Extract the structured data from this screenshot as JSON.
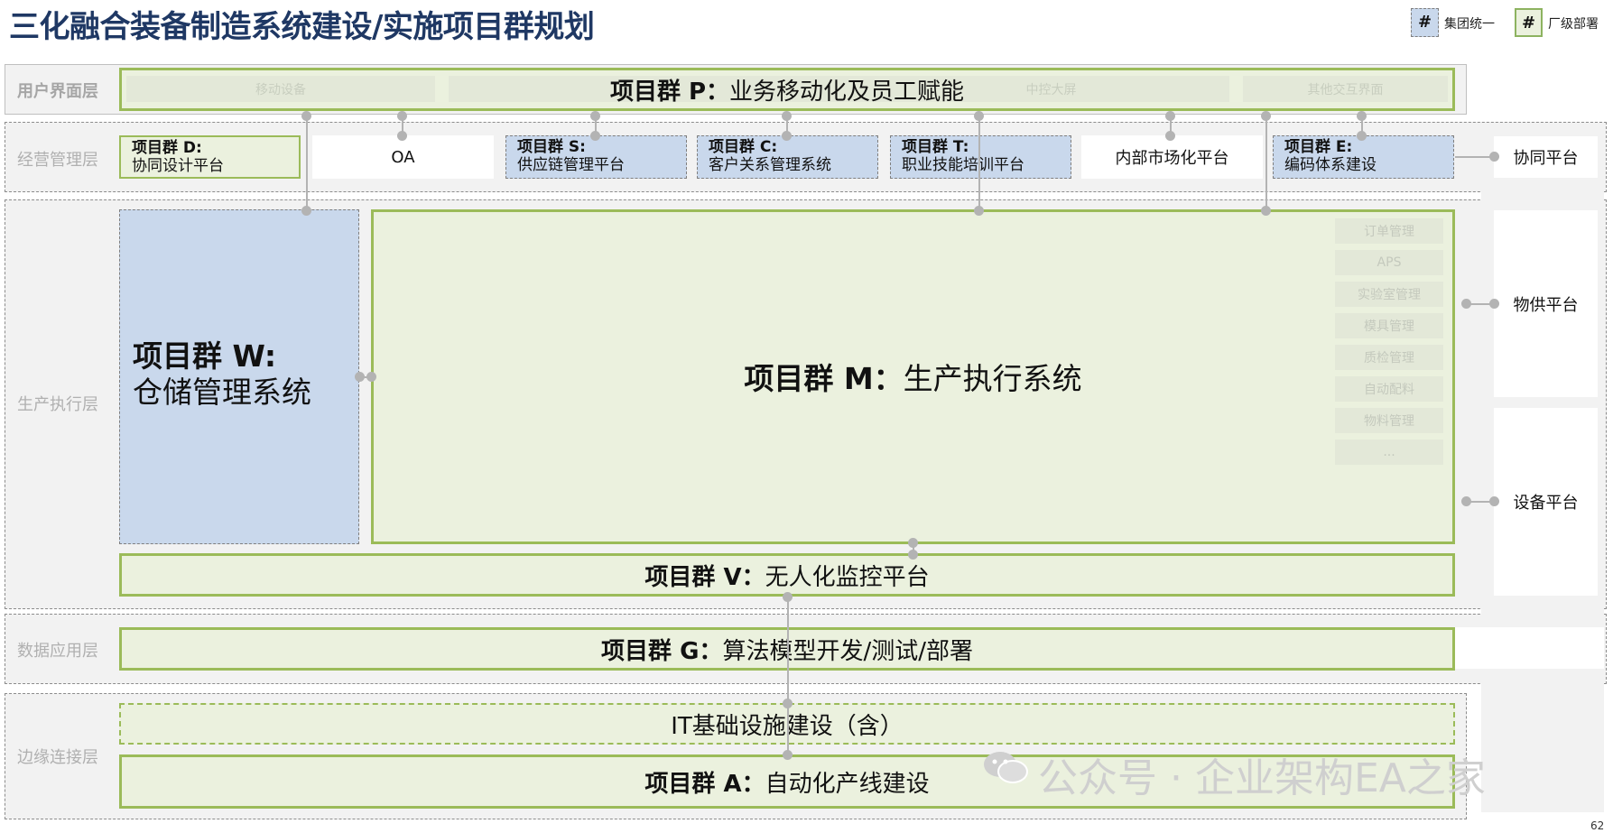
{
  "title": "三化融合装备制造系统建设/实施项目群规划",
  "legend": {
    "group_symbol": "#",
    "group_label": "集团统一",
    "plant_symbol": "#",
    "plant_label": "厂级部署"
  },
  "layers": {
    "ui": "用户界面层",
    "mgmt": "经营管理层",
    "prod": "生产执行层",
    "data": "数据应用层",
    "edge": "边缘连接层"
  },
  "ui_layer": {
    "project_p": {
      "name": "项目群 P：",
      "desc": "业务移动化及员工赋能"
    },
    "ghost": [
      "移动设备",
      "中控大屏",
      "其他交互界面"
    ]
  },
  "mgmt_layer": {
    "project_d": {
      "name": "项目群 D:",
      "desc": "协同设计平台"
    },
    "oa": "OA",
    "project_s": {
      "name": "项目群 S:",
      "desc": "供应链管理平台"
    },
    "project_c": {
      "name": "项目群 C:",
      "desc": "客户关系管理系统"
    },
    "project_t": {
      "name": "项目群 T:",
      "desc": "职业技能培训平台"
    },
    "internal_market": "内部市场化平台",
    "project_e": {
      "name": "项目群 E:",
      "desc": "编码体系建设"
    }
  },
  "prod_layer": {
    "project_w": {
      "name": "项目群 W:",
      "desc": "仓储管理系统"
    },
    "project_m": {
      "name": "项目群 M：",
      "desc": "生产执行系统"
    },
    "m_modules": [
      "订单管理",
      "APS",
      "实验室管理",
      "模具管理",
      "质检管理",
      "自动配料",
      "物料管理",
      "..."
    ],
    "project_v": {
      "name": "项目群 V：",
      "desc": "无人化监控平台"
    }
  },
  "data_layer": {
    "project_g": {
      "name": "项目群 G：",
      "desc": "算法模型开发/测试/部署"
    }
  },
  "edge_layer": {
    "it_infra": "IT基础设施建设（含）",
    "project_a": {
      "name": "项目群 A：",
      "desc": "自动化产线建设"
    }
  },
  "platforms": {
    "collab": "协同平台",
    "supply": "物供平台",
    "equipment": "设备平台"
  },
  "watermark": "公众号 · 企业架构EA之家",
  "page_number": "62",
  "colors": {
    "title": "#1f3864",
    "green_border": "#9bbb59",
    "green_fill": "#ebf1de",
    "blue_fill": "#c9d8ec",
    "band": "#f2f2f2"
  }
}
